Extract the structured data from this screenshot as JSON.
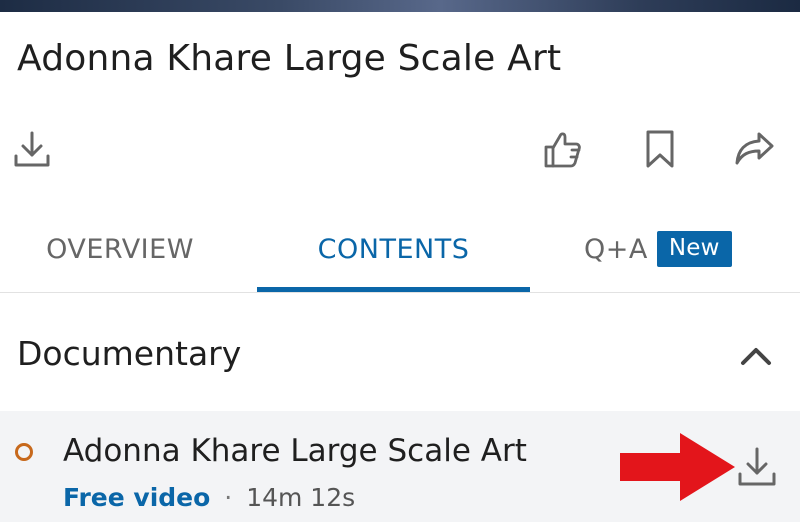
{
  "course": {
    "title": "Adonna Khare Large Scale Art"
  },
  "actions": {
    "download_icon": "download-icon",
    "like_icon": "thumbs-up-icon",
    "save_icon": "bookmark-icon",
    "share_icon": "share-icon"
  },
  "tabs": [
    {
      "label": "OVERVIEW",
      "active": false
    },
    {
      "label": "CONTENTS",
      "active": true
    },
    {
      "label": "Q+A",
      "active": false,
      "badge": "New"
    }
  ],
  "section": {
    "title": "Documentary",
    "toggle_icon": "chevron-up-icon"
  },
  "video": {
    "title": "Adonna Khare Large Scale Art",
    "free_label": "Free video",
    "separator": "·",
    "duration": "14m 12s",
    "status_icon": "progress-circle-icon",
    "download_icon": "download-icon"
  },
  "annotation": {
    "arrow_icon": "red-arrow-icon"
  },
  "colors": {
    "accent": "#0a66a8",
    "progress": "#c7691c",
    "arrow": "#e3151b",
    "row_background": "#f3f4f6"
  }
}
